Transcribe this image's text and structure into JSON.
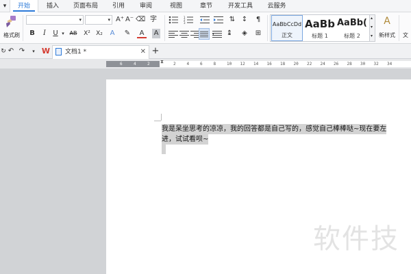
{
  "menu": {
    "tabs": [
      "开始",
      "插入",
      "页面布局",
      "引用",
      "审阅",
      "视图",
      "章节",
      "开发工具",
      "云服务"
    ],
    "active": "开始"
  },
  "ribbon": {
    "format_painter_label": "格式刷",
    "font_family_value": "",
    "font_size_value": "",
    "bold": "B",
    "italic": "I",
    "underline": "U",
    "strikethrough": "AB",
    "superscript": "X²",
    "subscript": "X₂",
    "grow_font": "A⁺",
    "shrink_font": "A⁻",
    "font_color": "A",
    "styles": [
      {
        "preview": "AaBbCcDd",
        "label": "正文"
      },
      {
        "preview": "AaBb",
        "label": "标题 1"
      },
      {
        "preview": "AaBb(",
        "label": "标题 2"
      }
    ],
    "new_style_label": "新样式",
    "text_tool_label": "文"
  },
  "tabbar": {
    "doc_tab_label": "文档1 *"
  },
  "ruler": {
    "left_ticks": [
      "6",
      "4",
      "2"
    ],
    "right_ticks": [
      "2",
      "4",
      "6",
      "8",
      "10",
      "12",
      "14",
      "16",
      "18",
      "20",
      "22",
      "24",
      "26",
      "28",
      "30",
      "32",
      "34"
    ]
  },
  "document": {
    "line1": "我是呆坐思考的凉凉，我的回答都是自己写的，感觉自己棒棒哒~现在要左",
    "line2": "进，试试看呗~"
  },
  "watermark": "软件技",
  "colors": {
    "accent": "#2b79d8",
    "selection": "#d3d3d3",
    "canvas": "#d1d3d6"
  }
}
